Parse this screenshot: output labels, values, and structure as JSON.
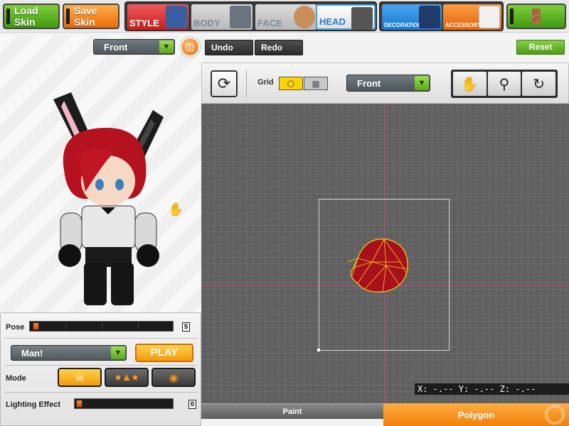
{
  "top_bar": {
    "load_skin": "Load Skin",
    "save_skin": "Save Skin",
    "categories": {
      "style": "STYLE",
      "body": "BODY",
      "face": "FACE",
      "head": "HEAD",
      "decoration": "DECORATION",
      "accessory": "ACCESSORY"
    },
    "selected_category": "HEAD"
  },
  "secondary_bar": {
    "view_select": "Front",
    "undo": "Undo",
    "redo": "Redo",
    "reset": "Reset"
  },
  "viewport_toolbar": {
    "grid_label": "Grid",
    "view_select": "Front",
    "tools": [
      "hand-icon",
      "zoom-icon",
      "camera-rotate-icon"
    ]
  },
  "viewport": {
    "coords": "X: -.-- Y: -.-- Z: -.--"
  },
  "mode_tabs": {
    "paint": "Paint",
    "polygon": "Polygon",
    "selected": "Polygon"
  },
  "control_panel": {
    "pose_label": "Pose",
    "pose_value": "5",
    "pose_select": "Man!",
    "play": "PLAY",
    "mode_label": "Mode",
    "lighting_label": "Lighting Effect",
    "lighting_value": "0"
  },
  "colors": {
    "accent_orange": "#f0800a",
    "accent_green": "#4e9c16",
    "viewport_bg": "#5f5f5f",
    "axis": "#d8457a"
  }
}
